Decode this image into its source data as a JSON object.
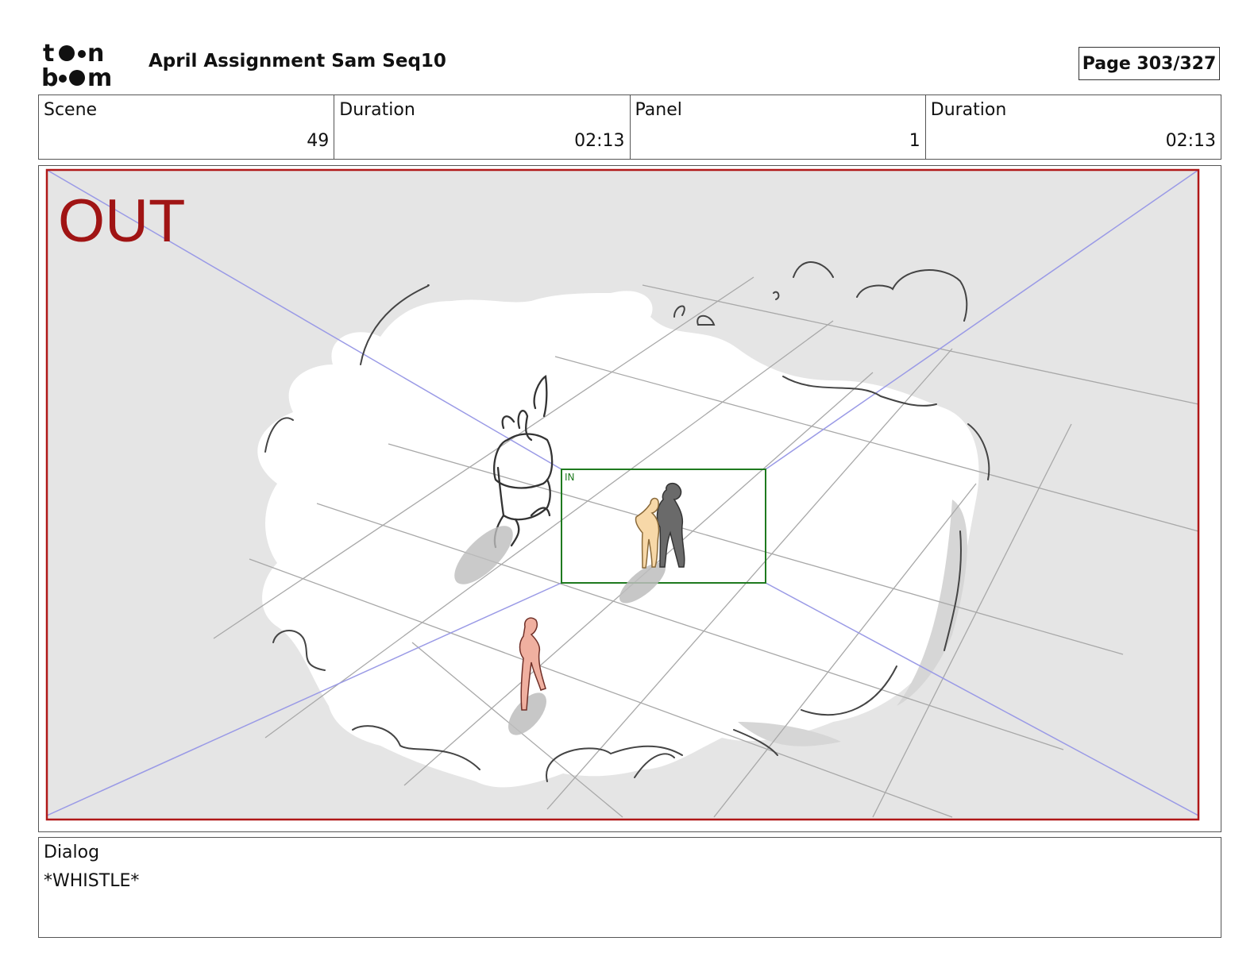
{
  "header": {
    "logo_text": "toon boom",
    "title": "April Assignment Sam Seq10",
    "page": "Page 303/327"
  },
  "info": {
    "scene_label": "Scene",
    "scene_value": "49",
    "scene_duration_label": "Duration",
    "scene_duration_value": "02:13",
    "panel_label": "Panel",
    "panel_value": "1",
    "panel_duration_label": "Duration",
    "panel_duration_value": "02:13"
  },
  "panel": {
    "out_label": "OUT",
    "in_label": "IN",
    "colors": {
      "out_frame": "#b01818",
      "in_frame": "#1f7a1f",
      "guides": "#9a9ae6",
      "background": "#e5e5e5"
    }
  },
  "dialog": {
    "label": "Dialog",
    "text": "*WHISTLE*"
  }
}
